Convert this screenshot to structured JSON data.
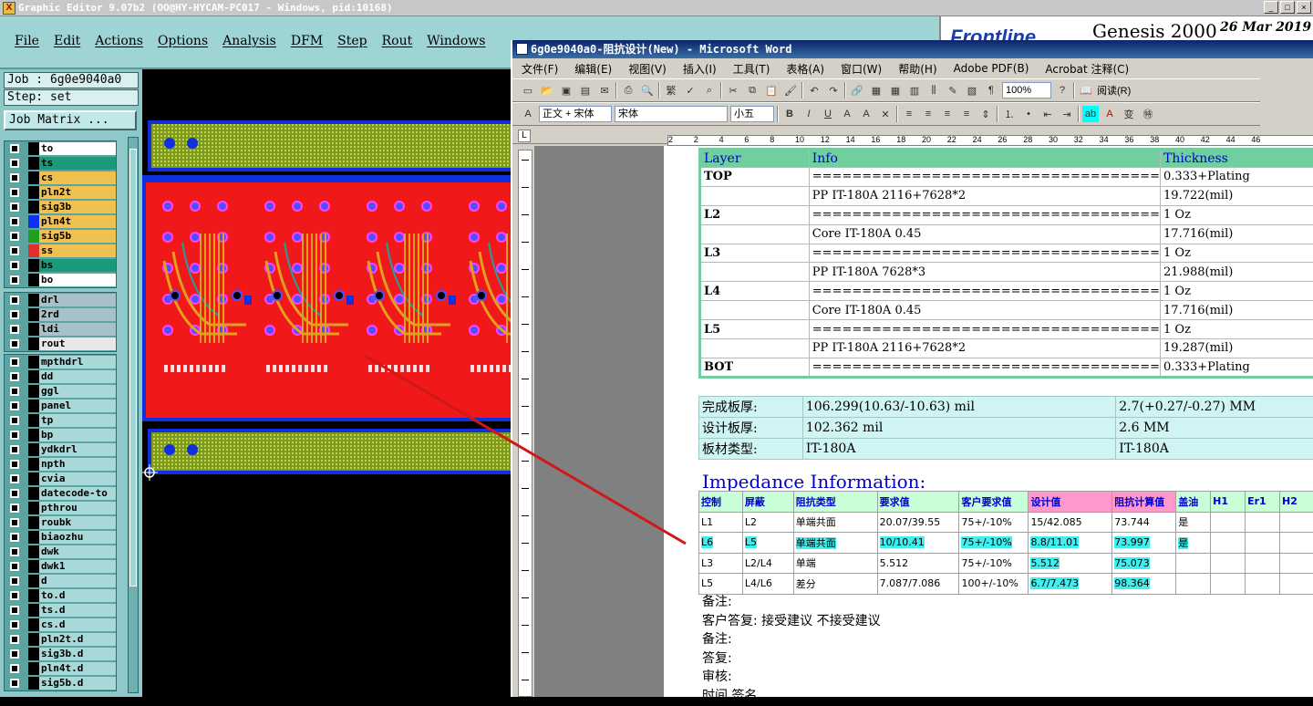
{
  "genesis": {
    "title": "Graphic Editor 9.07b2 (OO@HY-HYCAM-PC017 - Windows, pid:10168)",
    "menu": [
      "File",
      "Edit",
      "Actions",
      "Options",
      "Analysis",
      "DFM",
      "Step",
      "Rout",
      "Windows"
    ],
    "brand": "Genesis 2000",
    "date": "26 Mar 2019",
    "job": "Job : 6g0e9040a0",
    "step": "Step: set",
    "job_matrix": "Job Matrix ...",
    "layers_board": [
      {
        "name": "to",
        "color": "#ffffff"
      },
      {
        "name": "ts",
        "color": "#1a9a7a"
      },
      {
        "name": "cs",
        "color": "#f0c050"
      },
      {
        "name": "pln2t",
        "color": "#f0c050"
      },
      {
        "name": "sig3b",
        "color": "#f0c050"
      },
      {
        "name": "pln4t",
        "color": "#f0c050"
      },
      {
        "name": "sig5b",
        "color": "#f0c050"
      },
      {
        "name": "ss",
        "color": "#f0c050"
      },
      {
        "name": "bs",
        "color": "#1a9a7a"
      },
      {
        "name": "bo",
        "color": "#ffffff"
      }
    ],
    "layers_drill": [
      "drl",
      "2rd",
      "ldi",
      "rout"
    ],
    "layers_misc": [
      "mpthdrl",
      "dd",
      "ggl",
      "panel",
      "tp",
      "bp",
      "ydkdrl",
      "npth",
      "cvia",
      "datecode-to",
      "pthrou",
      "roubk",
      "biaozhu",
      "dwk",
      "dwk1",
      "d",
      "to.d",
      "ts.d",
      "cs.d",
      "pln2t.d",
      "sig3b.d",
      "pln4t.d",
      "sig5b.d"
    ]
  },
  "word": {
    "title": "6g0e9040a0-阻抗设计(New) - Microsoft Word",
    "menu": [
      "文件(F)",
      "编辑(E)",
      "视图(V)",
      "插入(I)",
      "工具(T)",
      "表格(A)",
      "窗口(W)",
      "帮助(H)",
      "Adobe PDF(B)",
      "Acrobat 注释(C)"
    ],
    "zoom": "100%",
    "read_btn": "阅读(R)",
    "style": "正文 + 宋体",
    "font": "宋体",
    "size": "小五",
    "ruler_ticks": [
      "2",
      "2",
      "4",
      "6",
      "8",
      "10",
      "12",
      "14",
      "16",
      "18",
      "20",
      "22",
      "24",
      "26",
      "28",
      "30",
      "32",
      "34",
      "36",
      "38",
      "40",
      "42",
      "44",
      "46"
    ],
    "stackup_header": [
      "Layer",
      "Info",
      "Thickness"
    ],
    "stackup": [
      [
        "TOP",
        "===================================",
        "0.333+Plating"
      ],
      [
        "",
        "PP    IT-180A    2116+7628*2",
        "19.722(mil)"
      ],
      [
        "L2",
        "===================================",
        "1 Oz"
      ],
      [
        "",
        "Core    IT-180A    0.45",
        "17.716(mil)"
      ],
      [
        "L3",
        "===================================",
        "1 Oz"
      ],
      [
        "",
        "PP    IT-180A    7628*3",
        "21.988(mil)"
      ],
      [
        "L4",
        "===================================",
        "1 Oz"
      ],
      [
        "",
        "Core    IT-180A    0.45",
        "17.716(mil)"
      ],
      [
        "L5",
        "===================================",
        "1 Oz"
      ],
      [
        "",
        "PP    IT-180A    2116+7628*2",
        "19.287(mil)"
      ],
      [
        "BOT",
        "===================================",
        "0.333+Plating"
      ]
    ],
    "board_info": [
      [
        "完成板厚:",
        "106.299(10.63/-10.63) mil",
        "2.7(+0.27/-0.27) MM"
      ],
      [
        "设计板厚:",
        "102.362 mil",
        "2.6 MM"
      ],
      [
        "板材类型:",
        "IT-180A",
        "IT-180A"
      ]
    ],
    "impedance_title": "Impedance Information:",
    "impedance_header": [
      "控制",
      "屏蔽",
      "阻抗类型",
      "要求值",
      "客户要求值",
      "设计值",
      "阻抗计算值",
      "盖油",
      "H1",
      "Er1",
      "H2"
    ],
    "impedance_rows": [
      [
        "L1",
        "L2",
        "单端共面",
        "20.07/39.55",
        "75+/-10%",
        "15/42.085",
        "73.744",
        "是",
        "",
        "",
        ""
      ],
      [
        "L6",
        "L5",
        "单端共面",
        "10/10.41",
        "75+/-10%",
        "8.8/11.01",
        "73.997",
        "是",
        "",
        "",
        ""
      ],
      [
        "L3",
        "L2/L4",
        "单端",
        "5.512",
        "75+/-10%",
        "5.512",
        "75.073",
        "",
        "",
        "",
        ""
      ],
      [
        "L5",
        "L4/L6",
        "差分",
        "7.087/7.086",
        "100+/-10%",
        "6.7/7.473",
        "98.364",
        "",
        "",
        "",
        ""
      ]
    ],
    "notes": [
      "备注:",
      "客户答复:                              接受建议                              不接受建议",
      "备注:",
      "答复:",
      "审核:",
      "时间                                                                  签名"
    ]
  }
}
